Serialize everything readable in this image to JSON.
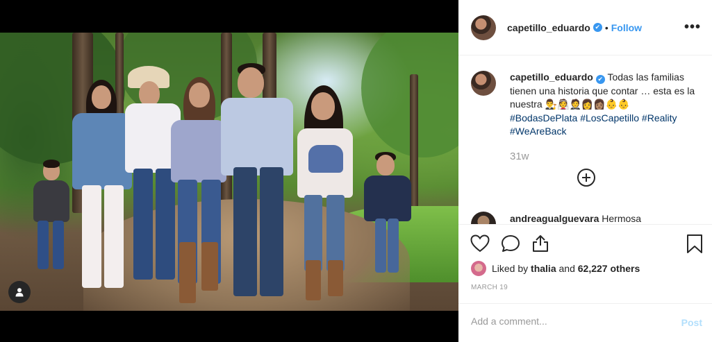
{
  "post": {
    "author": "capetillo_eduardo",
    "verified_mark": "✔",
    "follow_label": "Follow",
    "separator": "•",
    "more_label": "•••",
    "caption": {
      "text": "Todas las familias tienen una historia que contar … esta es la nuestra",
      "emojis": "👨‍⚖️👰🤵👩👩🏽👶👶",
      "hashtags": [
        "#BodasDePlata",
        "#LosCapetillo",
        "#Reality",
        "#WeAreBack"
      ],
      "time": "31w"
    },
    "comments": [
      {
        "user": "andreagualguevara",
        "text": "Hermosa"
      }
    ],
    "likes": {
      "prefix": "Liked by",
      "user": "thalia",
      "connector": "and",
      "others": "62,227 others"
    },
    "date": "MARCH 19",
    "comment_box": {
      "placeholder": "Add a comment...",
      "post_label": "Post"
    },
    "icons": {
      "like": "heart-icon",
      "comment": "comment-icon",
      "share": "share-icon",
      "save": "bookmark-icon",
      "load_more": "plus-circle-icon",
      "profile": "user-icon"
    }
  },
  "colors": {
    "accent": "#3897f0",
    "hashtag": "#003569",
    "muted": "#999999",
    "post_disabled": "#b2dffc"
  }
}
